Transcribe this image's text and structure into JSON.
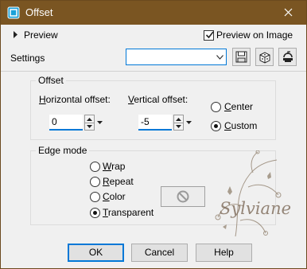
{
  "window": {
    "title": "Offset"
  },
  "preview": {
    "label": "Preview",
    "preview_on_image_label": "Preview on Image"
  },
  "settings": {
    "label": "Settings",
    "preset_value": ""
  },
  "offset_group": {
    "title": "Offset",
    "horizontal": {
      "label_prefix": "H",
      "label_rest": "orizontal offset:",
      "value": "0"
    },
    "vertical": {
      "label_prefix": "V",
      "label_rest": "ertical offset:",
      "value": "-5"
    },
    "center": {
      "prefix": "C",
      "rest": "enter"
    },
    "custom": {
      "prefix": "C",
      "rest": "ustom"
    }
  },
  "edge_group": {
    "title": "Edge mode",
    "wrap": {
      "prefix": "W",
      "rest": "rap"
    },
    "repeat": {
      "prefix": "R",
      "rest": "epeat"
    },
    "color": {
      "prefix": "C",
      "rest": "olor"
    },
    "transparent": {
      "prefix": "T",
      "rest": "ransparent"
    }
  },
  "buttons": {
    "ok": "OK",
    "cancel": "Cancel",
    "help": "Help"
  },
  "watermark": {
    "text": "Sylviane"
  },
  "colors": {
    "titlebar": "#7a5522",
    "accent": "#0078d7",
    "dialog_bg": "#f0f0f0"
  }
}
